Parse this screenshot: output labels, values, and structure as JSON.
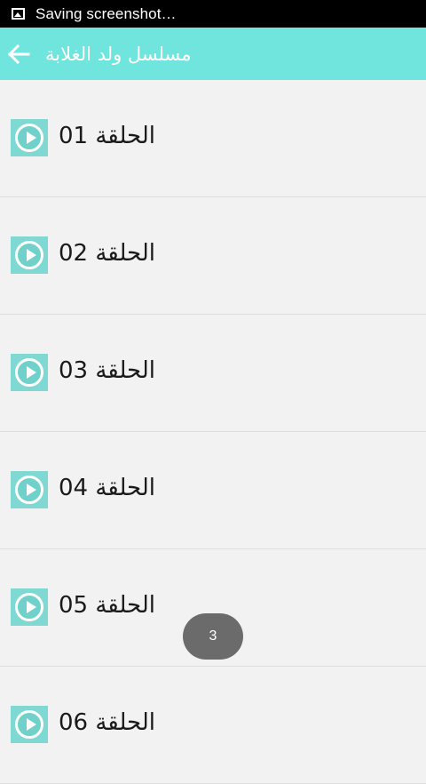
{
  "status_bar": {
    "icon": "image-icon",
    "text": "Saving screenshot…"
  },
  "app_bar": {
    "back_icon": "arrow-left-icon",
    "title": "مسلسل ولد الغلابة",
    "background": "#6fe5dd"
  },
  "episodes": [
    {
      "label": "الحلقة 01",
      "icon": "play-icon"
    },
    {
      "label": "الحلقة 02",
      "icon": "play-icon"
    },
    {
      "label": "الحلقة 03",
      "icon": "play-icon"
    },
    {
      "label": "الحلقة 04",
      "icon": "play-icon"
    },
    {
      "label": "الحلقة 05",
      "icon": "play-icon"
    },
    {
      "label": "الحلقة 06",
      "icon": "play-icon"
    }
  ],
  "toast": {
    "text": "3"
  }
}
